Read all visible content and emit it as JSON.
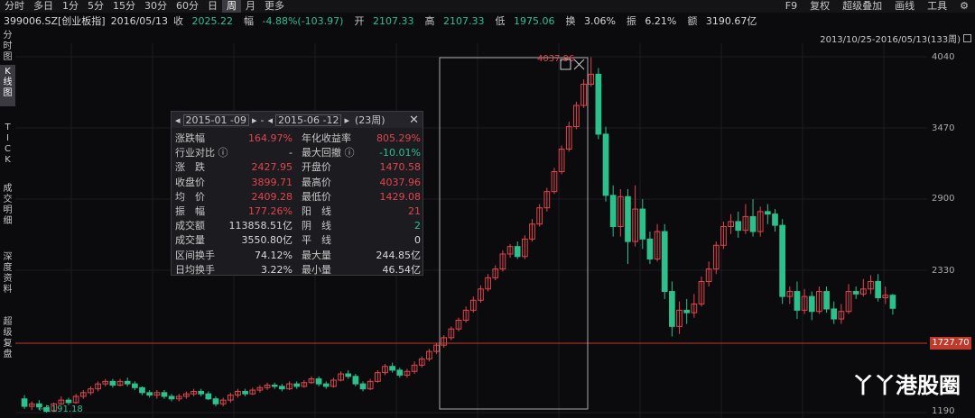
{
  "toolbar": {
    "timeframes": [
      "分时",
      "多日",
      "1分",
      "5分",
      "15分",
      "30分",
      "60分",
      "日",
      "周",
      "月",
      "更多"
    ],
    "active_timeframe": "周",
    "right_items": [
      "F9",
      "复权",
      "超级叠加",
      "画线",
      "工具"
    ]
  },
  "quote": {
    "code": "399006.SZ[创业板指]",
    "date": "2016/05/13",
    "close_label": "收",
    "close": "2025.22",
    "change_label": "幅",
    "change": "-4.88%(-103.97)",
    "open_label": "开",
    "open": "2107.33",
    "high_label": "高",
    "high": "2107.33",
    "low_label": "低",
    "low": "1975.06",
    "turnover_label": "换",
    "turnover": "3.06%",
    "amplitude_label": "振",
    "amplitude": "6.21%",
    "amount_label": "额",
    "amount": "3190.67亿"
  },
  "sidebar": [
    {
      "label": "分\n时\n图",
      "active": false
    },
    {
      "label": "K\n线\n图",
      "active": true
    },
    {
      "label": "T\nI\nC\nK",
      "active": false
    },
    {
      "label": "成\n交\n明\n细",
      "active": false
    },
    {
      "label": "深\n度\n资\n料",
      "active": false
    },
    {
      "label": "超\n级\n复\n盘",
      "active": false
    }
  ],
  "range_label": "2013/10/25-2016/05/13(133周)",
  "price_axis": [
    "4040",
    "3470",
    "2900",
    "2330",
    "1190"
  ],
  "current_price_tag": "1727.70",
  "max_label": "4037.96",
  "min_label": "←1191.18",
  "popup": {
    "start": "2015-01 -09",
    "end": "2015-06 -12",
    "weeks": "(23周)",
    "rows": [
      {
        "l1": "涨跌幅",
        "v1": "164.97%",
        "c1": "red",
        "l2": "年化收益率",
        "v2": "805.29%",
        "c2": "red"
      },
      {
        "l1": "行业对比 ⓘ",
        "v1": "-",
        "c1": "white",
        "l2": "最大回撤 ⓘ",
        "v2": "-10.01%",
        "c2": "green"
      },
      {
        "l1": "涨　跌",
        "v1": "2427.95",
        "c1": "red",
        "l2": "开盘价",
        "v2": "1470.58",
        "c2": "red"
      },
      {
        "l1": "收盘价",
        "v1": "3899.71",
        "c1": "red",
        "l2": "最高价",
        "v2": "4037.96",
        "c2": "red"
      },
      {
        "l1": "均　价",
        "v1": "2409.28",
        "c1": "red",
        "l2": "最低价",
        "v2": "1429.08",
        "c2": "red"
      },
      {
        "l1": "振　幅",
        "v1": "177.26%",
        "c1": "red",
        "l2": "阳　线",
        "v2": "21",
        "c2": "red"
      },
      {
        "l1": "成交额",
        "v1": "113858.51亿",
        "c1": "white",
        "l2": "阴　线",
        "v2": "2",
        "c2": "green"
      },
      {
        "l1": "成交量",
        "v1": "3550.80亿",
        "c1": "white",
        "l2": "平　线",
        "v2": "0",
        "c2": "white"
      },
      {
        "l1": "区间换手",
        "v1": "74.12%",
        "c1": "white",
        "l2": "最大量",
        "v2": "244.85亿",
        "c2": "white"
      },
      {
        "l1": "日均换手",
        "v1": "3.22%",
        "c1": "white",
        "l2": "最小量",
        "v2": "46.54亿",
        "c2": "white"
      }
    ]
  },
  "watermark": "丫丫港股圈",
  "colors": {
    "up": "#e0454d",
    "down": "#2dc08d",
    "bg": "#0b0b0d",
    "price_line": "#c0392b"
  },
  "chart_data": {
    "type": "candlestick",
    "ylim": [
      1190,
      4040
    ],
    "candles": [
      [
        1300,
        1240,
        1330,
        1220
      ],
      [
        1240,
        1260,
        1280,
        1210
      ],
      [
        1260,
        1235,
        1290,
        1215
      ],
      [
        1230,
        1200,
        1250,
        1191
      ],
      [
        1205,
        1260,
        1270,
        1195
      ],
      [
        1260,
        1290,
        1320,
        1250
      ],
      [
        1290,
        1270,
        1310,
        1250
      ],
      [
        1270,
        1320,
        1340,
        1260
      ],
      [
        1320,
        1350,
        1370,
        1300
      ],
      [
        1350,
        1380,
        1400,
        1330
      ],
      [
        1380,
        1420,
        1440,
        1360
      ],
      [
        1420,
        1440,
        1460,
        1400
      ],
      [
        1440,
        1410,
        1460,
        1390
      ],
      [
        1410,
        1440,
        1460,
        1400
      ],
      [
        1440,
        1420,
        1470,
        1400
      ],
      [
        1420,
        1390,
        1440,
        1370
      ],
      [
        1390,
        1350,
        1400,
        1330
      ],
      [
        1350,
        1330,
        1370,
        1310
      ],
      [
        1330,
        1350,
        1370,
        1300
      ],
      [
        1350,
        1320,
        1370,
        1300
      ],
      [
        1320,
        1300,
        1340,
        1280
      ],
      [
        1300,
        1320,
        1340,
        1280
      ],
      [
        1320,
        1340,
        1360,
        1300
      ],
      [
        1340,
        1360,
        1380,
        1320
      ],
      [
        1360,
        1340,
        1380,
        1320
      ],
      [
        1340,
        1300,
        1360,
        1290
      ],
      [
        1300,
        1260,
        1320,
        1240
      ],
      [
        1260,
        1290,
        1310,
        1240
      ],
      [
        1290,
        1330,
        1350,
        1270
      ],
      [
        1330,
        1360,
        1380,
        1310
      ],
      [
        1360,
        1340,
        1380,
        1320
      ],
      [
        1340,
        1370,
        1390,
        1330
      ],
      [
        1370,
        1390,
        1410,
        1350
      ],
      [
        1390,
        1410,
        1430,
        1370
      ],
      [
        1410,
        1400,
        1430,
        1380
      ],
      [
        1400,
        1380,
        1420,
        1360
      ],
      [
        1380,
        1420,
        1440,
        1370
      ],
      [
        1420,
        1400,
        1440,
        1380
      ],
      [
        1400,
        1430,
        1450,
        1390
      ],
      [
        1430,
        1460,
        1480,
        1420
      ],
      [
        1460,
        1420,
        1480,
        1400
      ],
      [
        1420,
        1400,
        1440,
        1380
      ],
      [
        1400,
        1450,
        1470,
        1390
      ],
      [
        1450,
        1500,
        1520,
        1440
      ],
      [
        1500,
        1480,
        1530,
        1460
      ],
      [
        1480,
        1420,
        1500,
        1400
      ],
      [
        1420,
        1380,
        1440,
        1360
      ],
      [
        1380,
        1440,
        1460,
        1370
      ],
      [
        1440,
        1510,
        1530,
        1430
      ],
      [
        1510,
        1560,
        1580,
        1490
      ],
      [
        1560,
        1530,
        1590,
        1510
      ],
      [
        1530,
        1490,
        1550,
        1470
      ],
      [
        1490,
        1520,
        1540,
        1470
      ],
      [
        1520,
        1570,
        1600,
        1500
      ],
      [
        1570,
        1620,
        1640,
        1550
      ],
      [
        1620,
        1680,
        1700,
        1600
      ],
      [
        1680,
        1730,
        1750,
        1660
      ],
      [
        1730,
        1790,
        1810,
        1710
      ],
      [
        1790,
        1860,
        1880,
        1770
      ],
      [
        1860,
        1930,
        1950,
        1840
      ],
      [
        1930,
        2010,
        2040,
        1910
      ],
      [
        2010,
        2090,
        2120,
        1990
      ],
      [
        2090,
        2180,
        2210,
        2070
      ],
      [
        2180,
        2270,
        2300,
        2160
      ],
      [
        2270,
        2340,
        2370,
        2250
      ],
      [
        2340,
        2460,
        2490,
        2320
      ],
      [
        2460,
        2520,
        2540,
        2430
      ],
      [
        2520,
        2440,
        2560,
        2420
      ],
      [
        2440,
        2580,
        2610,
        2420
      ],
      [
        2580,
        2700,
        2740,
        2560
      ],
      [
        2700,
        2830,
        2860,
        2680
      ],
      [
        2830,
        2960,
        2990,
        2800
      ],
      [
        2960,
        3120,
        3150,
        2940
      ],
      [
        3120,
        3300,
        3330,
        3100
      ],
      [
        3300,
        3480,
        3520,
        3280
      ],
      [
        3480,
        3650,
        3680,
        3460
      ],
      [
        3650,
        3820,
        3860,
        3630
      ],
      [
        3820,
        3900,
        4037,
        3800
      ],
      [
        3900,
        3420,
        3950,
        3380
      ],
      [
        3420,
        2930,
        3480,
        2880
      ],
      [
        2930,
        2680,
        3010,
        2600
      ],
      [
        2680,
        2920,
        2980,
        2600
      ],
      [
        2920,
        2560,
        2980,
        2380
      ],
      [
        2560,
        2820,
        3010,
        2520
      ],
      [
        2820,
        2580,
        2900,
        2500
      ],
      [
        2580,
        2420,
        2640,
        2380
      ],
      [
        2420,
        2640,
        2700,
        2400
      ],
      [
        2640,
        2160,
        2700,
        2100
      ],
      [
        2160,
        1880,
        2240,
        1800
      ],
      [
        1880,
        2010,
        2080,
        1820
      ],
      [
        2010,
        1990,
        2100,
        1900
      ],
      [
        1990,
        2060,
        2140,
        1950
      ],
      [
        2060,
        2240,
        2280,
        2040
      ],
      [
        2240,
        2340,
        2400,
        2200
      ],
      [
        2340,
        2530,
        2560,
        2300
      ],
      [
        2530,
        2680,
        2720,
        2500
      ],
      [
        2680,
        2720,
        2780,
        2620
      ],
      [
        2720,
        2650,
        2800,
        2590
      ],
      [
        2650,
        2760,
        2860,
        2620
      ],
      [
        2760,
        2640,
        2900,
        2600
      ],
      [
        2640,
        2800,
        2840,
        2600
      ],
      [
        2800,
        2780,
        2860,
        2700
      ],
      [
        2780,
        2690,
        2820,
        2640
      ],
      [
        2690,
        2120,
        2740,
        2060
      ],
      [
        2120,
        2160,
        2200,
        2060
      ],
      [
        2160,
        2010,
        2240,
        1940
      ],
      [
        2010,
        2120,
        2180,
        1980
      ],
      [
        2120,
        2000,
        2160,
        1930
      ],
      [
        2000,
        2160,
        2200,
        1980
      ],
      [
        2160,
        2020,
        2200,
        1990
      ],
      [
        2020,
        1940,
        2080,
        1900
      ],
      [
        1940,
        2000,
        2060,
        1900
      ],
      [
        2000,
        2160,
        2220,
        1980
      ],
      [
        2160,
        2140,
        2200,
        2100
      ],
      [
        2140,
        2180,
        2260,
        2120
      ],
      [
        2180,
        2240,
        2290,
        2140
      ],
      [
        2240,
        2110,
        2300,
        2080
      ],
      [
        2110,
        2130,
        2200,
        2060
      ],
      [
        2130,
        2025,
        2140,
        1975
      ]
    ]
  }
}
